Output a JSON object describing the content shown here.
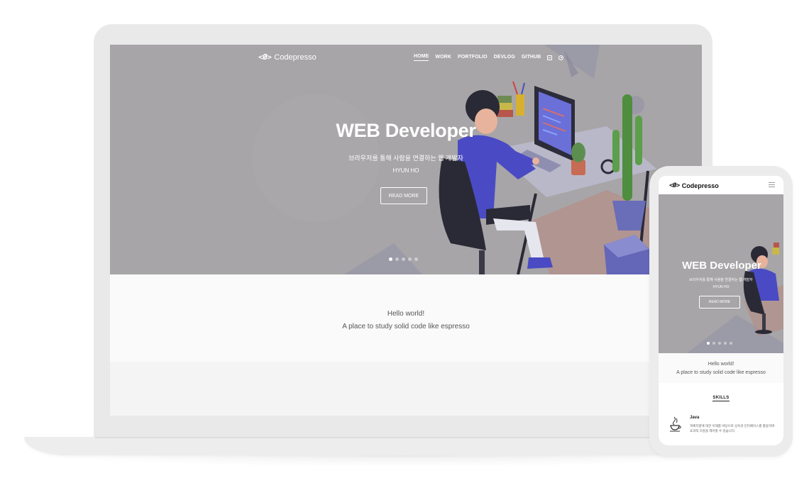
{
  "site": {
    "logo_mark": "<Ø>",
    "brand_name": "Codepresso"
  },
  "nav": {
    "items": [
      {
        "label": "HOME",
        "active": true
      },
      {
        "label": "WORK",
        "active": false
      },
      {
        "label": "PORTFOLIO",
        "active": false
      },
      {
        "label": "DEVLOG",
        "active": false
      },
      {
        "label": "GITHUB",
        "active": false
      }
    ],
    "icons": [
      "document-icon",
      "user-icon"
    ]
  },
  "hero": {
    "title": "WEB Developer",
    "subtitle": "브라우저를 통해 사람을 연결하는 웹 개발자",
    "name": "HYUN HO",
    "button_label": "READ MORE",
    "slide_count": 5,
    "active_slide": 1
  },
  "intro": {
    "line1": "Hello world!",
    "line2": "A place to study solid code like espresso"
  },
  "mobile": {
    "menu_icon": "hamburger-icon",
    "skills_heading": "SKILLS",
    "skill": {
      "name": "Java",
      "icon": "java-cup-icon",
      "description": "객체지향에 대한 이해를 바탕으로 상속과 인터페이스를 활용하여 효과적 흐름을 제어할 수 있습니다."
    }
  },
  "colors": {
    "hero_bg": "#a7a5a7",
    "device_frame": "#e9e9e9",
    "illustration_blue": "#4a4bc4"
  }
}
